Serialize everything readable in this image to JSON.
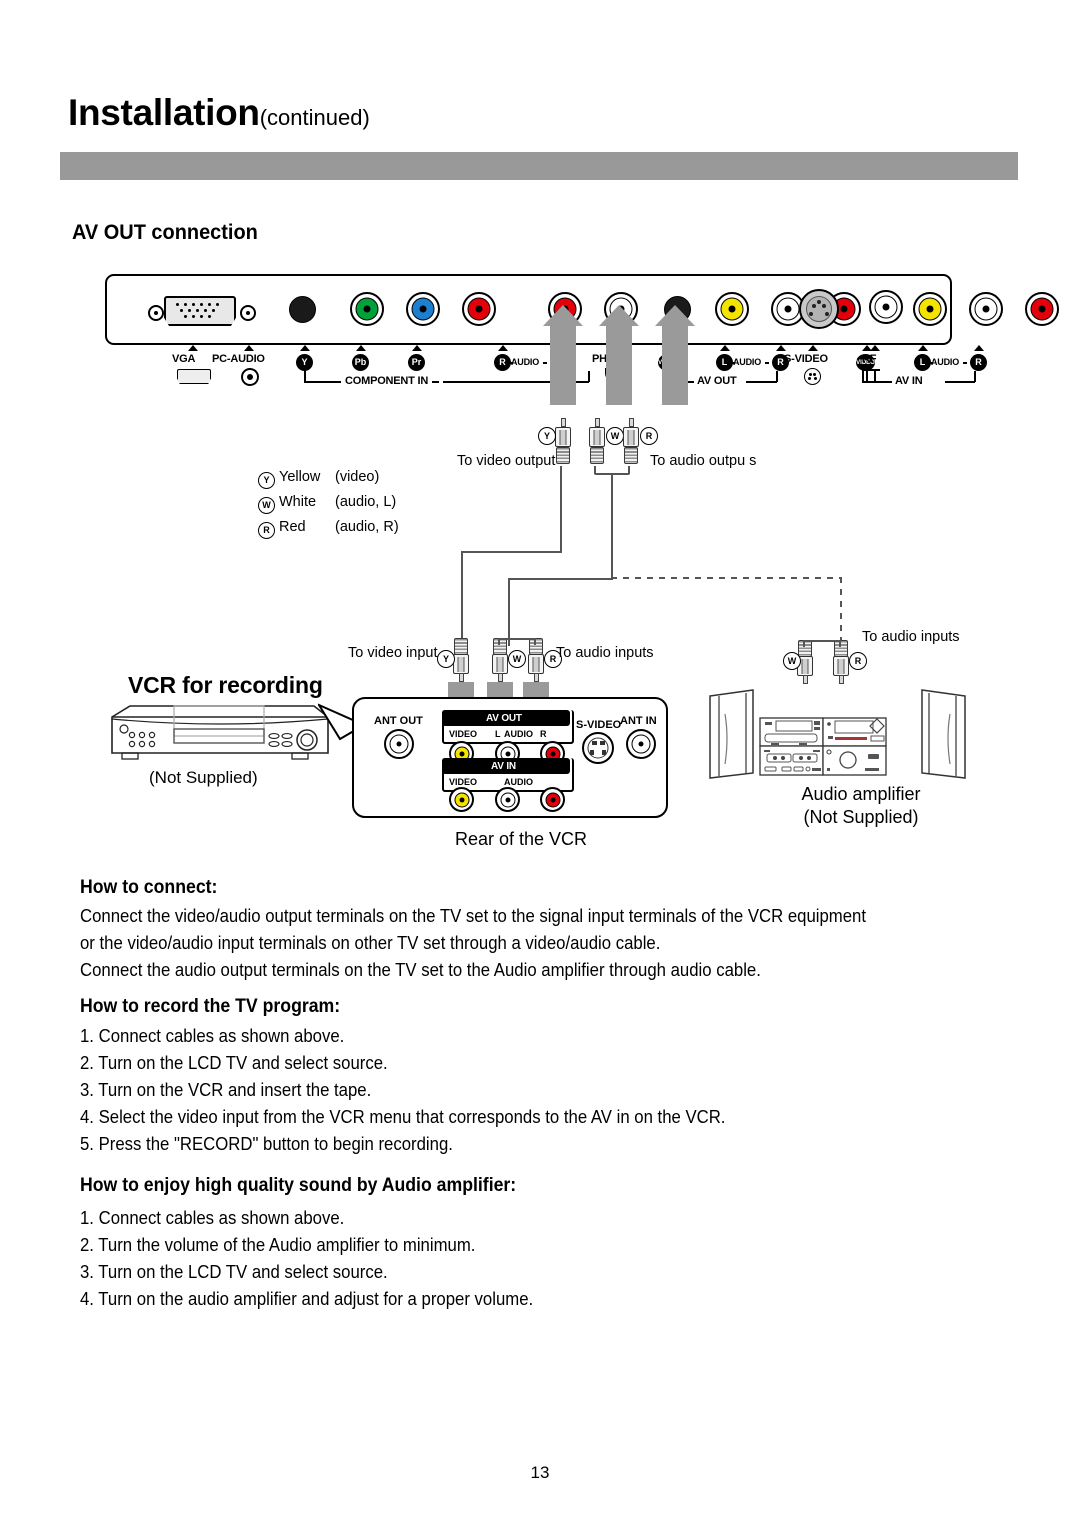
{
  "header": {
    "title": "Installation",
    "title_suffix": "(continued)",
    "section_heading": "AV OUT connection"
  },
  "tv_panel": {
    "jack_labels": [
      {
        "name": "VGA",
        "text": "VGA"
      },
      {
        "name": "PC-AUDIO",
        "text": "PC-AUDIO"
      },
      {
        "name": "Y",
        "text": "Y"
      },
      {
        "name": "Pb",
        "text": "Pb"
      },
      {
        "name": "Pr",
        "text": "Pr"
      },
      {
        "name": "R",
        "text": "R"
      },
      {
        "name": "AUDIO",
        "text": "AUDIO"
      },
      {
        "name": "L",
        "text": "L"
      },
      {
        "name": "PHONE",
        "text": "PHONE"
      },
      {
        "name": "VIDEO-OUT",
        "text": "VIDEO"
      },
      {
        "name": "AUDIO-OUT",
        "text": "AUDIO"
      },
      {
        "name": "R-OUT",
        "text": "R"
      },
      {
        "name": "VIDEO-IN",
        "text": "VIDEO"
      },
      {
        "name": "L-IN",
        "text": "L"
      },
      {
        "name": "AUDIO-IN",
        "text": "AUDIO"
      },
      {
        "name": "R-IN",
        "text": "R"
      },
      {
        "name": "S-VIDEO",
        "text": "S-VIDEO"
      },
      {
        "name": "RF",
        "text": "RF"
      }
    ],
    "groups": {
      "component_in": "COMPONENT IN",
      "av_out": "AV OUT",
      "av_in": "AV IN"
    },
    "jack_colors": {
      "y_green": "#00a13a",
      "pb_blue": "#1d7fd0",
      "pr_red": "#e3000b",
      "audio_r_red": "#e3000b",
      "audio_l_white": "#ffffff",
      "video_yellow": "#f5e400",
      "black": "#1a1a1a",
      "arrow_gray": "#9a9a9a"
    }
  },
  "cables": {
    "tv_video_label": "To video output",
    "tv_audio_label": "To audio outpu s",
    "vcr_video_label": "To video input",
    "vcr_audio_label": "To audio inputs",
    "amp_audio_label": "To audio inputs",
    "plug_y": "Y",
    "plug_w": "W",
    "plug_r": "R"
  },
  "legend": [
    {
      "badge": "Y",
      "name": "Yellow",
      "desc": "(video)"
    },
    {
      "badge": "W",
      "name": "White",
      "desc": "(audio, L)"
    },
    {
      "badge": "R",
      "name": "Red",
      "desc": "(audio, R)"
    }
  ],
  "vcr": {
    "title": "VCR for recording",
    "not_supplied": "(Not Supplied)",
    "caption": "Rear of the VCR",
    "panel_labels": {
      "ant_out": "ANT OUT",
      "ant_in": "ANT IN",
      "s_video": "S-VIDEO",
      "av_out": "AV OUT",
      "av_in": "AV IN",
      "video": "VIDEO",
      "audio_l": "L",
      "audio": "AUDIO",
      "audio_r": "R"
    }
  },
  "amplifier": {
    "name": "Audio amplifier",
    "not_supplied": "(Not Supplied)"
  },
  "body": {
    "how_to_connect_heading": "How to connect:",
    "how_to_connect_lines": [
      "Connect the video/audio output terminals on the TV set to the signal input terminals of the VCR equipment",
      "or the video/audio input terminals on other TV set through a video/audio cable.",
      "Connect the audio output terminals on the TV set to the Audio amplifier through audio cable."
    ],
    "how_to_record_heading": "How to record the TV program:",
    "how_to_record_steps": [
      "1. Connect cables as shown above.",
      "2. Turn on the LCD TV and select source.",
      "3. Turn on the VCR and insert the tape.",
      "4. Select the video input from the VCR menu that corresponds to the AV in on the VCR.",
      "5. Press the \"RECORD\" button to begin recording."
    ],
    "how_to_enjoy_heading": "How to enjoy high quality sound by Audio amplifier:",
    "how_to_enjoy_steps": [
      "1. Connect cables as shown above.",
      "2. Turn the volume of the Audio amplifier to minimum.",
      "3. Turn on the LCD TV and select source.",
      "4. Turn on the audio amplifier and adjust for a proper volume."
    ]
  },
  "page_number": "13"
}
